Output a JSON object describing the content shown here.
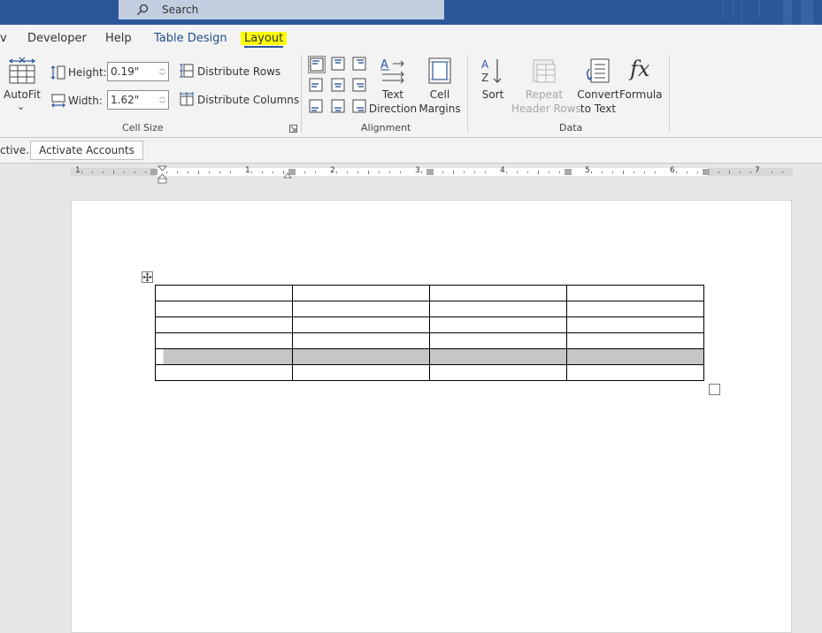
{
  "search": {
    "placeholder": "Search"
  },
  "tabs": [
    {
      "label": "v"
    },
    {
      "label": "Developer"
    },
    {
      "label": "Help"
    },
    {
      "label": "Table Design"
    },
    {
      "label": "Layout",
      "active": true
    }
  ],
  "ribbon": {
    "cell_size": {
      "autofit": "AutoFit",
      "autofit_chevron": "⌄",
      "height_label": "Height:",
      "height_value": "0.19\"",
      "width_label": "Width:",
      "width_value": "1.62\"",
      "distribute_rows": "Distribute Rows",
      "distribute_columns": "Distribute Columns",
      "group_label": "Cell Size"
    },
    "alignment": {
      "text_direction_1": "Text",
      "text_direction_2": "Direction",
      "cell_margins_1": "Cell",
      "cell_margins_2": "Margins",
      "group_label": "Alignment"
    },
    "data": {
      "sort": "Sort",
      "repeat_header_rows_1": "Repeat",
      "repeat_header_rows_2": "Header Rows",
      "convert_to_text_1": "Convert",
      "convert_to_text_2": "to Text",
      "formula": "Formula",
      "group_label": "Data"
    }
  },
  "message_bar": {
    "text": "ctive.",
    "button": "Activate Accounts"
  },
  "ruler": {
    "numbers": [
      "1",
      "1",
      "2",
      "3",
      "4",
      "5",
      "6",
      "7"
    ]
  },
  "document": {
    "rows": 6,
    "cols": 4,
    "shaded_row": 5
  },
  "colors": {
    "title_bar": "#2b579a",
    "ribbon_bg": "#f3f3f3",
    "active_tab_highlight": "#ffff00",
    "accent_blue": "#2b579a",
    "shaded_row": "#c6c6c6"
  }
}
